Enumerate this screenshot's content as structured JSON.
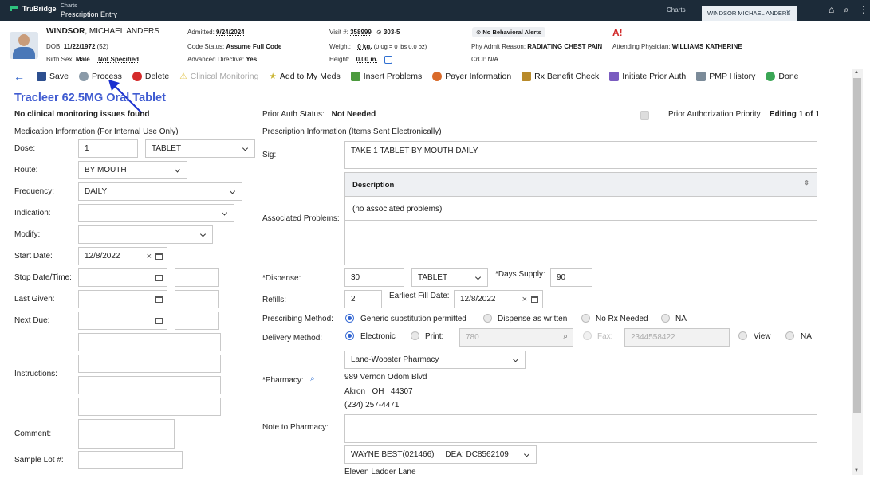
{
  "topbar": {
    "brand": "TruBridge",
    "crumb_small": "Charts",
    "crumb_main": "Prescription Entry",
    "charts_tab": "Charts",
    "patient_tab": "WINDSOR MICHAEL ANDERS",
    "close": "×",
    "home_icon": "home-icon",
    "search_icon": "search-icon",
    "menu_icon": "more-icon"
  },
  "patient": {
    "last": "WINDSOR",
    "first": ", MICHAEL ANDERS",
    "dob_label": "DOB:",
    "dob": "11/22/1972",
    "age": "(52)",
    "sex_label": "Birth Sex:",
    "sex": "Male",
    "sex_extra": "Not Specified",
    "admitted_label": "Admitted:",
    "admitted": "9/24/2024",
    "code_label": "Code Status:",
    "code": "Assume Full Code",
    "adv_label": "Advanced Directive:",
    "adv": "Yes",
    "visit_label": "Visit #:",
    "visit": "358999",
    "room": "303-5",
    "weight_label": "Weight:",
    "weight": "0 kg.",
    "weight_extra": "(0.0g = 0 lbs 0.0 oz)",
    "height_label": "Height:",
    "height": "0.00 in.",
    "alerts": "No Behavioral Alerts",
    "reason_label": "Phy Admit Reason:",
    "reason": "RADIATING CHEST PAIN",
    "crcl_label": "CrCl:",
    "crcl": "N/A",
    "allergy": "A!",
    "attending_label": "Attending Physician:",
    "attending": "WILLIAMS KATHERINE"
  },
  "toolbar": {
    "back": "←",
    "save": "Save",
    "process": "Process",
    "delete": "Delete",
    "clinical": "Clinical Monitoring",
    "add_meds": "Add to My Meds",
    "insert_problems": "Insert Problems",
    "payer": "Payer Information",
    "rx_benefit": "Rx Benefit Check",
    "prior_auth": "Initiate Prior Auth",
    "pmp": "PMP History",
    "done": "Done"
  },
  "colors": {
    "accent": "#3f5bd1",
    "topbar": "#1c2b39",
    "radio": "#2f62d0"
  },
  "left": {
    "title": "Tracleer 62.5MG Oral Tablet",
    "no_issues": "No clinical monitoring issues found",
    "section": "Medication Information (For Internal Use Only)",
    "dose_label": "Dose:",
    "dose": "1",
    "dose_unit": "TABLET",
    "route_label": "Route:",
    "route": "BY MOUTH",
    "freq_label": "Frequency:",
    "freq": "DAILY",
    "indication_label": "Indication:",
    "modify_label": "Modify:",
    "start_label": "Start Date:",
    "start": "12/8/2022",
    "stop_label": "Stop Date/Time:",
    "last_label": "Last Given:",
    "next_label": "Next Due:",
    "instructions_label": "Instructions:",
    "comment_label": "Comment:",
    "lot_label": "Sample Lot #:"
  },
  "right": {
    "prior_status_label": "Prior Auth Status:",
    "prior_status": "Not Needed",
    "priority_label": "Prior Authorization Priority",
    "editing": "Editing 1 of 1",
    "section": "Prescription Information (Items Sent Electronically)",
    "sig_label": "Sig:",
    "sig": "TAKE 1 TABLET BY MOUTH DAILY",
    "assoc_label": "Associated Problems:",
    "desc_header": "Description",
    "no_problems": "(no associated problems)",
    "dispense_label": "*Dispense:",
    "dispense": "30",
    "dispense_unit": "TABLET",
    "days_label": "*Days Supply:",
    "days": "90",
    "refills_label": "Refills:",
    "refills": "2",
    "earliest_label": "Earliest Fill Date:",
    "earliest": "12/8/2022",
    "presc_label": "Prescribing Method:",
    "presc_opts": [
      "Generic substitution permitted",
      "Dispense as written",
      "No Rx Needed",
      "NA"
    ],
    "deliv_label": "Delivery Method:",
    "deliv_opts": [
      "Electronic",
      "Print:",
      "Fax:",
      "View",
      "NA"
    ],
    "print_value": "780",
    "fax_value": "2344558422",
    "pharmacy_label": "*Pharmacy:",
    "pharmacy": "Lane-Wooster Pharmacy",
    "pharm_addr1": "989 Vernon Odom Blvd",
    "pharm_city": "Akron",
    "pharm_state": "OH",
    "pharm_zip": "44307",
    "pharm_phone": "(234) 257-4471",
    "note_label": "Note to Pharmacy:",
    "prescriber": "WAYNE BEST(021466)     DEA: DC8562109",
    "prescriber_addr": "Eleven Ladder Lane"
  }
}
